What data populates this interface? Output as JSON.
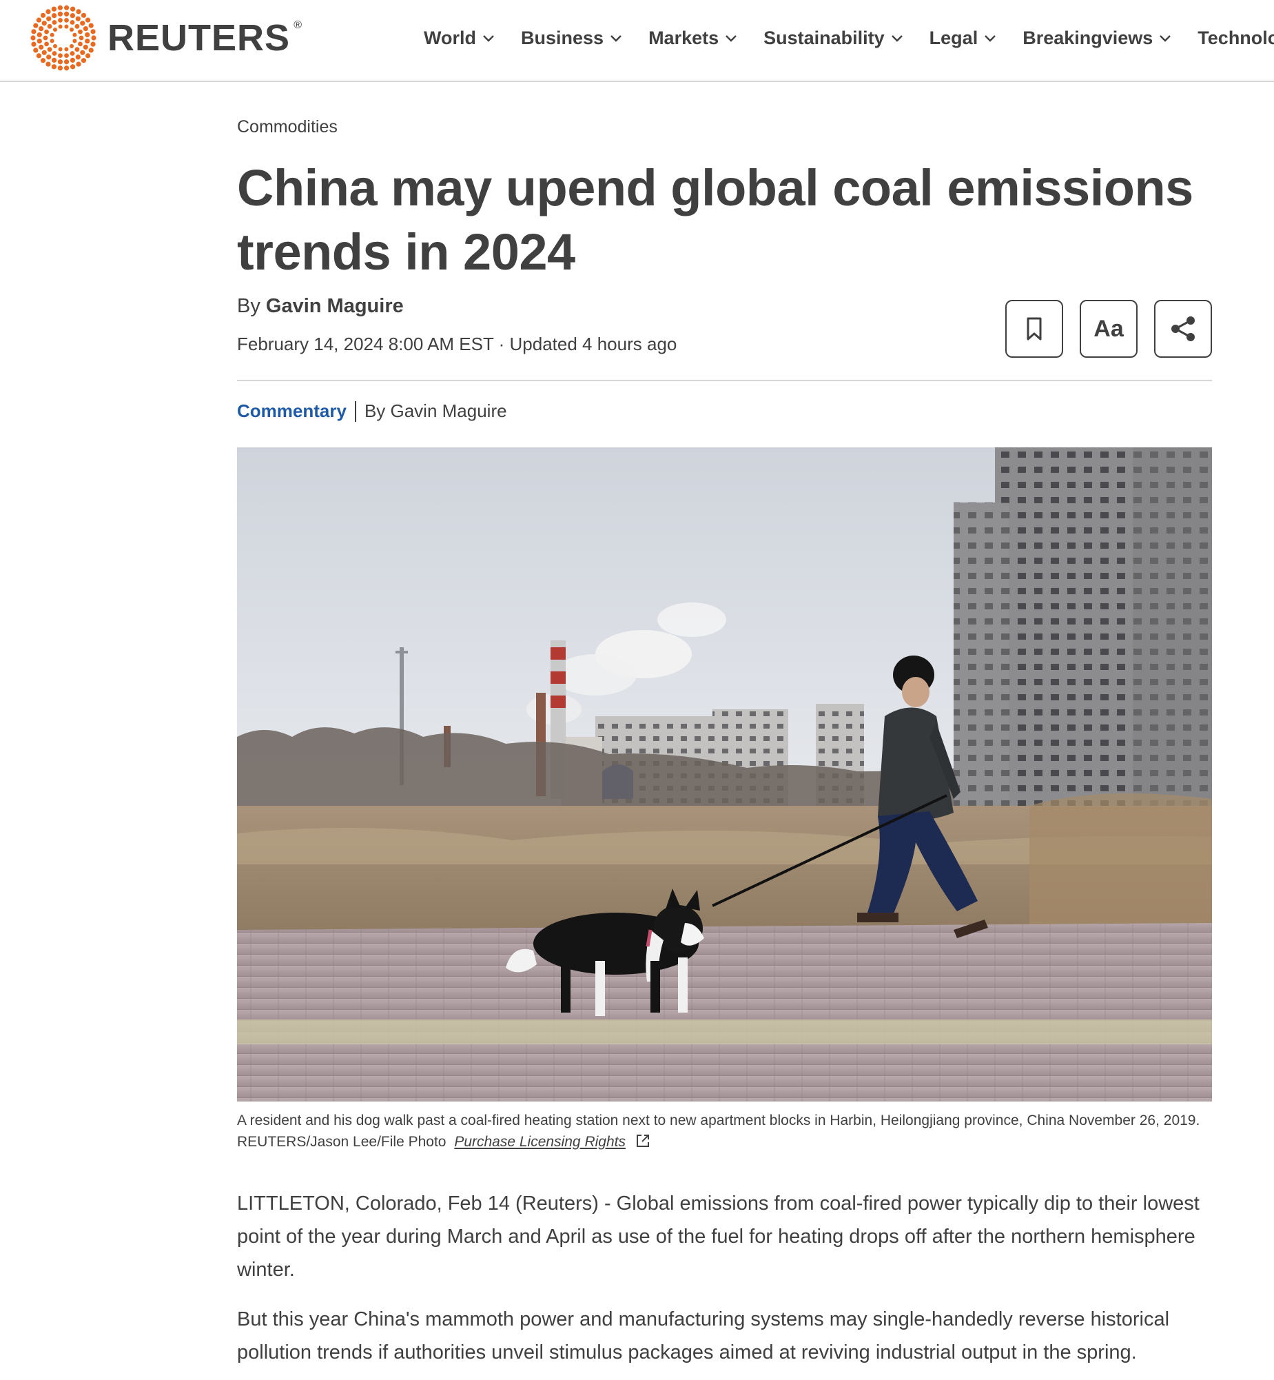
{
  "brand": {
    "name": "REUTERS",
    "registered_mark": "®",
    "accent": "#e8691f"
  },
  "nav": {
    "items": [
      {
        "label": "World"
      },
      {
        "label": "Business"
      },
      {
        "label": "Markets"
      },
      {
        "label": "Sustainability"
      },
      {
        "label": "Legal"
      },
      {
        "label": "Breakingviews"
      },
      {
        "label": "Technology"
      }
    ]
  },
  "article": {
    "section": "Commodities",
    "headline": "China may upend global coal emissions trends in 2024",
    "byline_prefix": "By",
    "author": "Gavin Maguire",
    "date": "February 14, 2024 8:00 AM EST · Updated 4 hours ago",
    "tools": {
      "bookmark_icon": "bookmark-icon",
      "font_size_label": "Aa",
      "share_icon": "share-icon"
    },
    "commentary_tag": "Commentary",
    "commentary_byline": "By Gavin Maguire",
    "tag_color": "#1f5aa6",
    "photo": {
      "caption": "A resident and his dog walk past a coal-fired heating station next to new apartment blocks in Harbin, Heilongjiang province, China November 26, 2019. REUTERS/Jason Lee/File Photo",
      "license_link": "Purchase Licensing Rights",
      "license_icon": "external-link-icon"
    },
    "paragraphs": [
      "LITTLETON, Colorado, Feb 14 (Reuters) - Global emissions from coal-fired power typically dip to their lowest point of the year during March and April as use of the fuel for heating drops off after the northern hemisphere winter.",
      "But this year China's mammoth power and manufacturing systems may single-handedly reverse historical pollution trends if authorities unveil stimulus packages aimed at reviving industrial output in the spring."
    ]
  }
}
